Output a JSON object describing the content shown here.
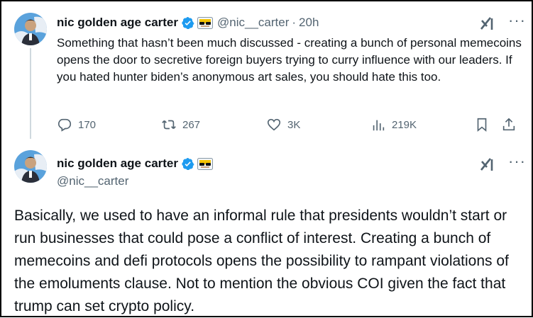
{
  "tweet1": {
    "author_name": "nic golden age carter",
    "handle": "@nic__carter",
    "separator": "·",
    "timestamp": "20h",
    "text": "Something that hasn’t been much discussed - creating a bunch of personal memecoins opens the door to secretive foreign buyers trying to curry influence with our leaders. If you hated hunter biden’s anonymous art sales, you should hate this too.",
    "stats": {
      "replies": "170",
      "reposts": "267",
      "likes": "3K",
      "views": "219K"
    }
  },
  "tweet2": {
    "author_name": "nic golden age carter",
    "handle": "@nic__carter",
    "text": "Basically, we used to have an informal rule that presidents wouldn’t start or run businesses that could pose a conflict of interest. Creating a bunch of memecoins and defi protocols opens the possibility to rampant violations of the emoluments clause. Not to mention the obvious COI given the fact that trump can set crypto policy."
  },
  "menu_glyph": "···",
  "colors": {
    "text": "#0f1419",
    "secondary": "#536471",
    "verified_blue": "#1d9bf0",
    "thread_line": "#cfd9de",
    "border": "#000000"
  },
  "icons": [
    "verified-badge-icon",
    "affiliate-badge-icon",
    "grok-icon",
    "more-icon",
    "reply-icon",
    "repost-icon",
    "like-icon",
    "views-icon",
    "bookmark-icon",
    "share-icon"
  ]
}
